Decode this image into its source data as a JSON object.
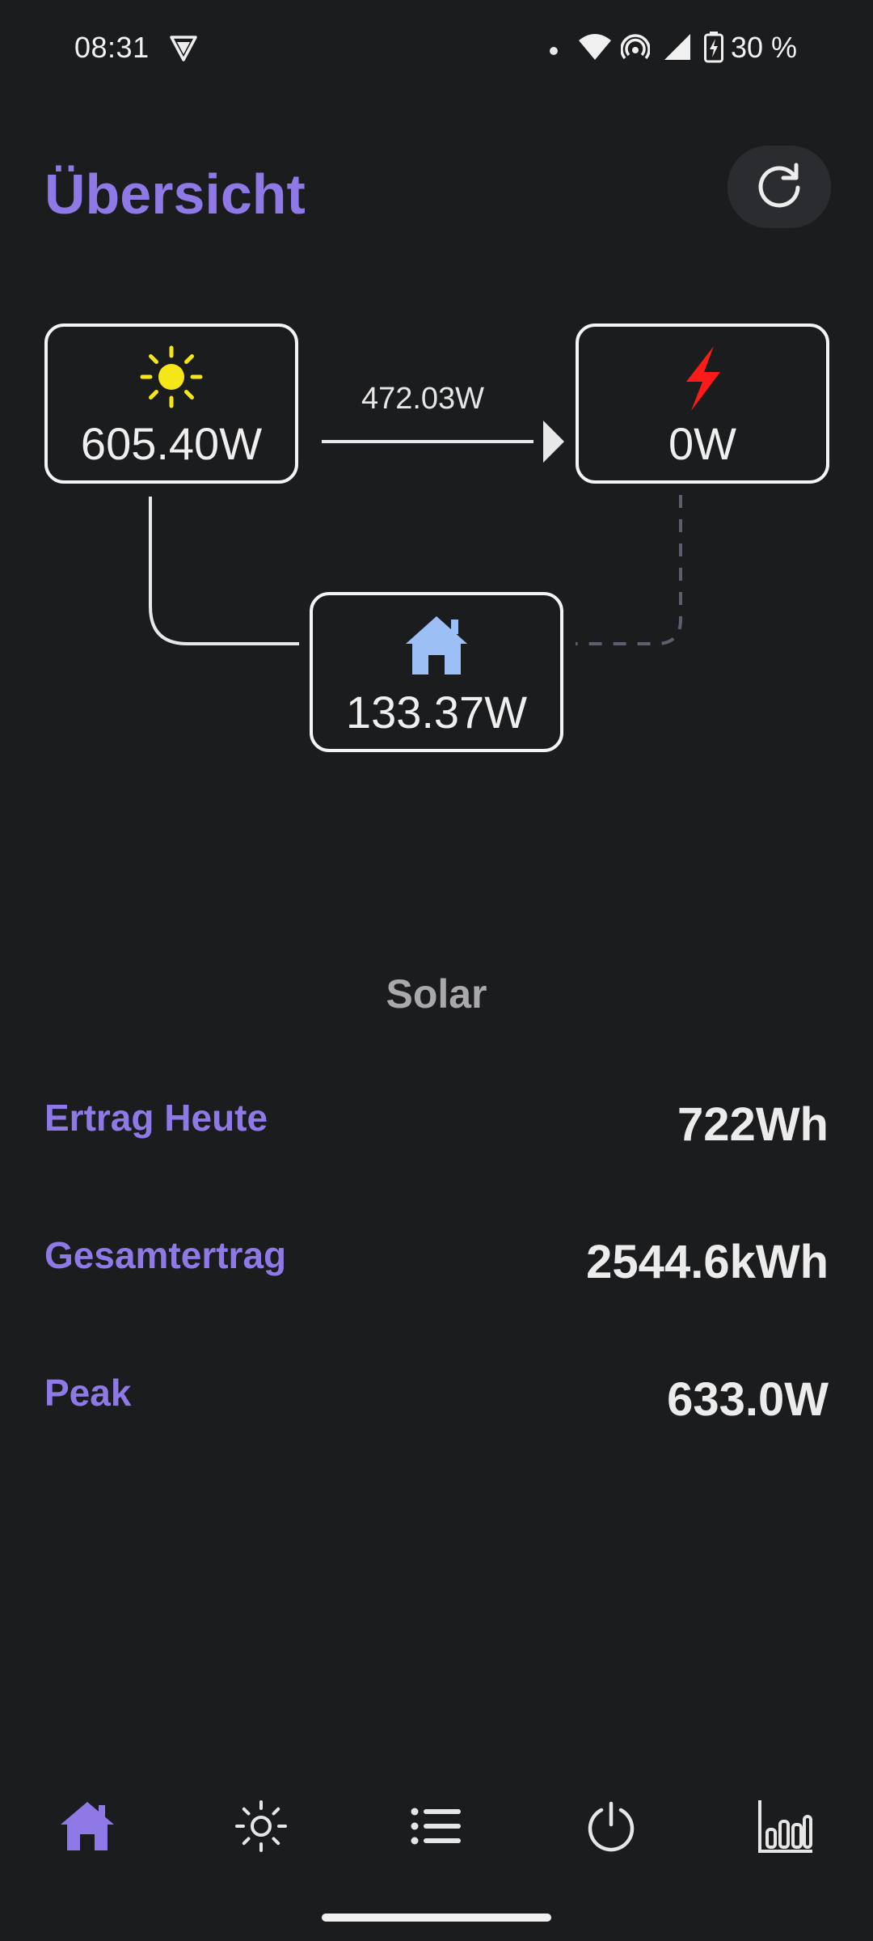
{
  "status_bar": {
    "time": "08:31",
    "battery_percent": "30 %",
    "icons": [
      "vpn-shield-icon",
      "dot-icon",
      "wifi-icon",
      "hotspot-icon",
      "cell-signal-icon",
      "battery-charging-icon"
    ]
  },
  "header": {
    "title": "Übersicht",
    "refresh_icon": "refresh-icon"
  },
  "flow": {
    "solar": {
      "icon": "sun-icon",
      "value": "605.40W",
      "color": "#f5e61a"
    },
    "grid": {
      "icon": "lightning-icon",
      "value": "0W",
      "color": "#ff1a1a"
    },
    "home": {
      "icon": "house-icon",
      "value": "133.37W",
      "color": "#9cc0f5"
    },
    "solar_to_grid_label": "472.03W"
  },
  "solar_section": {
    "title": "Solar",
    "stats": [
      {
        "label": "Ertrag Heute",
        "value": "722Wh"
      },
      {
        "label": "Gesamtertrag",
        "value": "2544.6kWh"
      },
      {
        "label": "Peak",
        "value": "633.0W"
      }
    ]
  },
  "bottom_nav": {
    "items": [
      {
        "icon": "home-icon",
        "active": true
      },
      {
        "icon": "sun-outline-icon",
        "active": false
      },
      {
        "icon": "list-icon",
        "active": false
      },
      {
        "icon": "power-icon",
        "active": false
      },
      {
        "icon": "bar-chart-icon",
        "active": false
      }
    ]
  },
  "colors": {
    "accent": "#8f79e6",
    "background": "#1b1c1e",
    "card_border": "#f4f4f4",
    "dashed_line": "#5c5f6e"
  }
}
